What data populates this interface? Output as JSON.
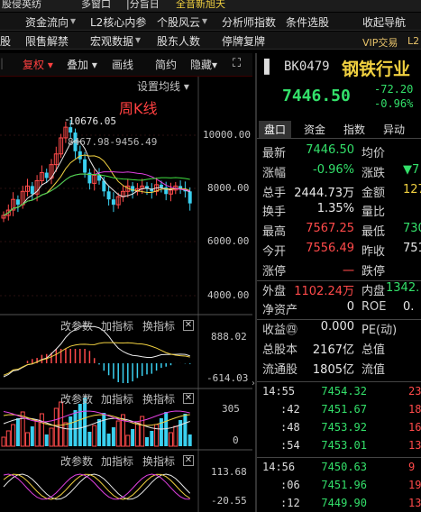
{
  "top_strip": {
    "left": "股侵英纺",
    "mid1": "多窗口",
    "mid2": "|分旨日",
    "mid3": "全音新旭天"
  },
  "menu1": [
    "资金流向",
    "L2核心内参",
    "个股风云",
    "分析师指数",
    "条件选股",
    "收起导航"
  ],
  "menu2": [
    "股",
    "限售解禁",
    "宏观数据",
    "股东人数",
    "停牌复牌",
    "VIP交易",
    "L2"
  ],
  "chart_toolbar": {
    "fq": "复权",
    "overlay": "叠加",
    "draw": "画线",
    "simple": "简约",
    "hide": "隐藏",
    "fs": "⛶"
  },
  "main_panel": {
    "title": "周K线",
    "setting": "设置均线",
    "high_label": "10676.05",
    "ma_text": "8467.98-9456.49",
    "yaxis": [
      "10000.00",
      "8000.00",
      "6000.00",
      "4000.00"
    ]
  },
  "sub1": {
    "btn1": "改参数",
    "btn2": "加指标",
    "btn3": "换指标",
    "close": "✕",
    "ymax": "888.02",
    "ymin": "-614.03"
  },
  "sub2": {
    "btn1": "改参数",
    "btn2": "加指标",
    "btn3": "换指标",
    "close": "✕",
    "y1": "305",
    "y2": "0"
  },
  "sub3": {
    "btn1": "改参数",
    "btn2": "加指标",
    "btn3": "换指标",
    "close": "✕",
    "ymax": "113.68",
    "ymin": "-20.55"
  },
  "quote": {
    "code": "BK0479",
    "name": "钢铁行业",
    "price": "7446.50",
    "change": "-72.20",
    "change_pct": "-0.96%",
    "tabs": [
      "盘口",
      "资金",
      "指数",
      "异动"
    ],
    "rows": [
      {
        "l": "最新",
        "v": "7446.50",
        "vc": "green",
        "l2": "均价",
        "v2": ""
      },
      {
        "l": "涨幅",
        "v": "-0.96%",
        "vc": "green",
        "l2": "涨跌",
        "v2": "▼7",
        "v2c": "green"
      },
      {
        "l": "总手",
        "v": "2444.73万",
        "vc": "white",
        "l2": "金额",
        "v2": "127.",
        "v2c": "yellow"
      },
      {
        "l": "换手",
        "v": "1.35%",
        "vc": "white",
        "l2": "量比",
        "v2": ""
      },
      {
        "l": "最高",
        "v": "7567.25",
        "vc": "red",
        "l2": "最低",
        "v2": "730",
        "v2c": "green"
      },
      {
        "l": "今开",
        "v": "7556.49",
        "vc": "red",
        "l2": "昨收",
        "v2": "751",
        "v2c": "white"
      },
      {
        "l": "涨停",
        "v": "一",
        "vc": "red",
        "l2": "跌停",
        "v2": ""
      },
      {
        "l": "外盘",
        "v": "1102.24万",
        "vc": "red",
        "l2": "内盘",
        "v2": "1342.",
        "v2c": "green"
      },
      {
        "l": "净资产",
        "v": "0",
        "vc": "white",
        "l2": "ROE",
        "v2": "0.",
        "v2c": "white"
      },
      {
        "l": "收益㊃",
        "v": "0.000",
        "vc": "white",
        "l2": "PE(动)",
        "v2": ""
      },
      {
        "l": "总股本",
        "v": "2167亿",
        "vc": "white",
        "l2": "总值",
        "v2": ""
      },
      {
        "l": "流通股",
        "v": "1805亿",
        "vc": "white",
        "l2": "流值",
        "v2": ""
      }
    ],
    "ticks": [
      {
        "t": "14:55",
        "p": "7454.32",
        "q": "23"
      },
      {
        "t": ":42",
        "p": "7451.67",
        "q": "18"
      },
      {
        "t": ":48",
        "p": "7453.92",
        "q": "16"
      },
      {
        "t": ":54",
        "p": "7453.01",
        "q": "13"
      },
      {
        "t": "14:56",
        "p": "7450.63",
        "q": "9"
      },
      {
        "t": ":06",
        "p": "7451.96",
        "q": "19"
      },
      {
        "t": ":12",
        "p": "7449.90",
        "q": "13"
      },
      {
        "t": ":18",
        "p": "7450.54",
        "q": "11"
      }
    ]
  },
  "colors": {
    "up": "#ff4a4a",
    "down": "#33e06a",
    "ma5": "#e8e8e8",
    "ma10": "#f0d040",
    "ma20": "#e040e0",
    "ma60": "#40e040"
  }
}
